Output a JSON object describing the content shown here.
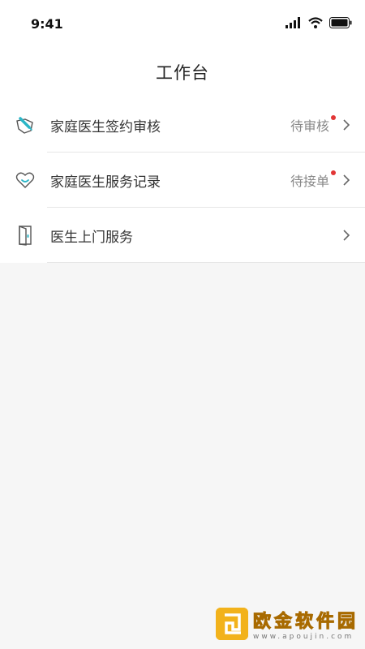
{
  "status_bar": {
    "time": "9:41"
  },
  "header": {
    "title": "工作台"
  },
  "menu": {
    "items": [
      {
        "label": "家庭医生签约审核",
        "status": "待审核",
        "has_badge": true,
        "icon": "signing-review-icon"
      },
      {
        "label": "家庭医生服务记录",
        "status": "待接单",
        "has_badge": true,
        "icon": "heart-icon"
      },
      {
        "label": "医生上门服务",
        "status": "",
        "has_badge": false,
        "icon": "door-icon"
      }
    ]
  },
  "watermark": {
    "title": "欧金软件园",
    "subtitle": "www.apoujin.com"
  },
  "colors": {
    "badge": "#e23636",
    "accent": "#2bb6c7",
    "watermark": "#f2b21b"
  }
}
